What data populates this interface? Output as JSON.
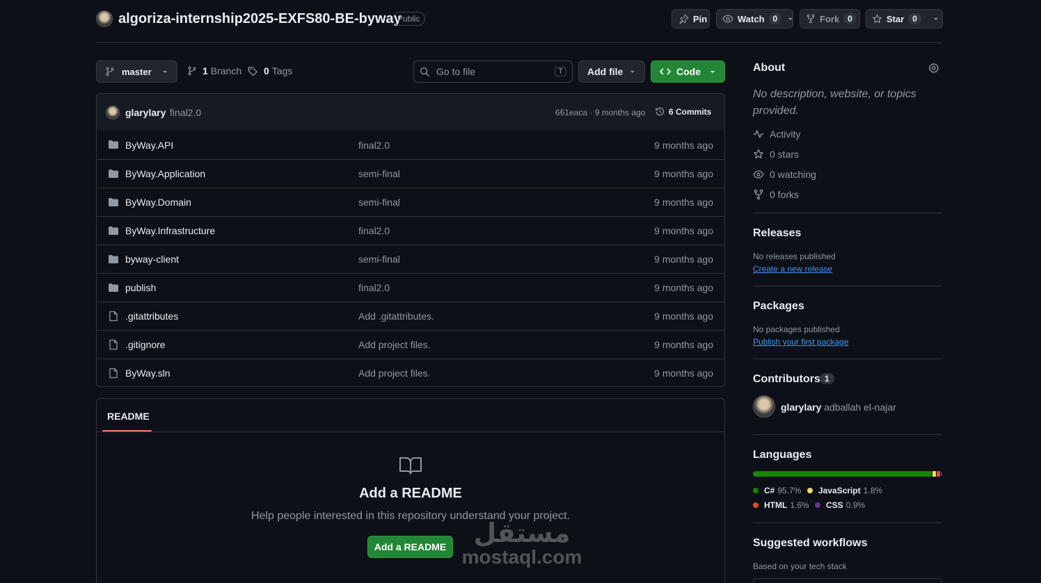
{
  "repo": {
    "name": "algoriza-internship2025-EXFS80-BE-byway",
    "visibility": "Public"
  },
  "header_actions": {
    "pin_label": "Pin",
    "watch_label": "Watch",
    "watch_count": "0",
    "fork_label": "Fork",
    "fork_count": "0",
    "star_label": "Star",
    "star_count": "0"
  },
  "toolbar": {
    "branch": "master",
    "branch_count": "1",
    "branch_label": "Branch",
    "tag_count": "0",
    "tag_label": "Tags",
    "search_placeholder": "Go to file",
    "search_shortcut": "T",
    "add_file_label": "Add file",
    "code_label": "Code"
  },
  "latest_commit": {
    "author": "glarylary",
    "message": "final2.0",
    "hash_age": "661eaca · 9 months ago",
    "commits_label": "6 Commits"
  },
  "files": [
    {
      "type": "dir",
      "name": "ByWay.API",
      "message": "final2.0",
      "age": "9 months ago"
    },
    {
      "type": "dir",
      "name": "ByWay.Application",
      "message": "semi-final",
      "age": "9 months ago"
    },
    {
      "type": "dir",
      "name": "ByWay.Domain",
      "message": "semi-final",
      "age": "9 months ago"
    },
    {
      "type": "dir",
      "name": "ByWay.Infrastructure",
      "message": "final2.0",
      "age": "9 months ago"
    },
    {
      "type": "dir",
      "name": "byway-client",
      "message": "semi-final",
      "age": "9 months ago"
    },
    {
      "type": "dir",
      "name": "publish",
      "message": "final2.0",
      "age": "9 months ago"
    },
    {
      "type": "file",
      "name": ".gitattributes",
      "message": "Add .gitattributes.",
      "age": "9 months ago"
    },
    {
      "type": "file",
      "name": ".gitignore",
      "message": "Add project files.",
      "age": "9 months ago"
    },
    {
      "type": "file",
      "name": "ByWay.sln",
      "message": "Add project files.",
      "age": "9 months ago"
    }
  ],
  "readme": {
    "tab_label": "README",
    "title": "Add a README",
    "description": "Help people interested in this repository understand your project.",
    "button_label": "Add a README"
  },
  "about": {
    "heading": "About",
    "description": "No description, website, or topics provided.",
    "stats": {
      "activity": "Activity",
      "stars": "0 stars",
      "watching": "0 watching",
      "forks": "0 forks"
    }
  },
  "releases": {
    "heading": "Releases",
    "note": "No releases published",
    "link": "Create a new release"
  },
  "packages": {
    "heading": "Packages",
    "note": "No packages published",
    "link": "Publish your first package"
  },
  "contributors": {
    "heading": "Contributors",
    "count": "1",
    "login": "glarylary",
    "full_name": "adballah el-najar"
  },
  "languages": {
    "heading": "Languages",
    "items": [
      {
        "name": "C#",
        "percent": "95.7%",
        "value": 95.7,
        "color": "#178600"
      },
      {
        "name": "JavaScript",
        "percent": "1.8%",
        "value": 1.8,
        "color": "#f1e05a"
      },
      {
        "name": "HTML",
        "percent": "1.6%",
        "value": 1.6,
        "color": "#e34c26"
      },
      {
        "name": "CSS",
        "percent": "0.9%",
        "value": 0.9,
        "color": "#663399"
      }
    ]
  },
  "workflows": {
    "heading": "Suggested workflows",
    "note": "Based on your tech stack"
  },
  "watermark": {
    "arabic": "مستقل",
    "latin": "mostaql.com"
  },
  "colors": {
    "background": "#0d1117",
    "border": "#30363d",
    "accent_green": "#238636",
    "link": "#4493f8",
    "readme_underline": "#f78166"
  }
}
